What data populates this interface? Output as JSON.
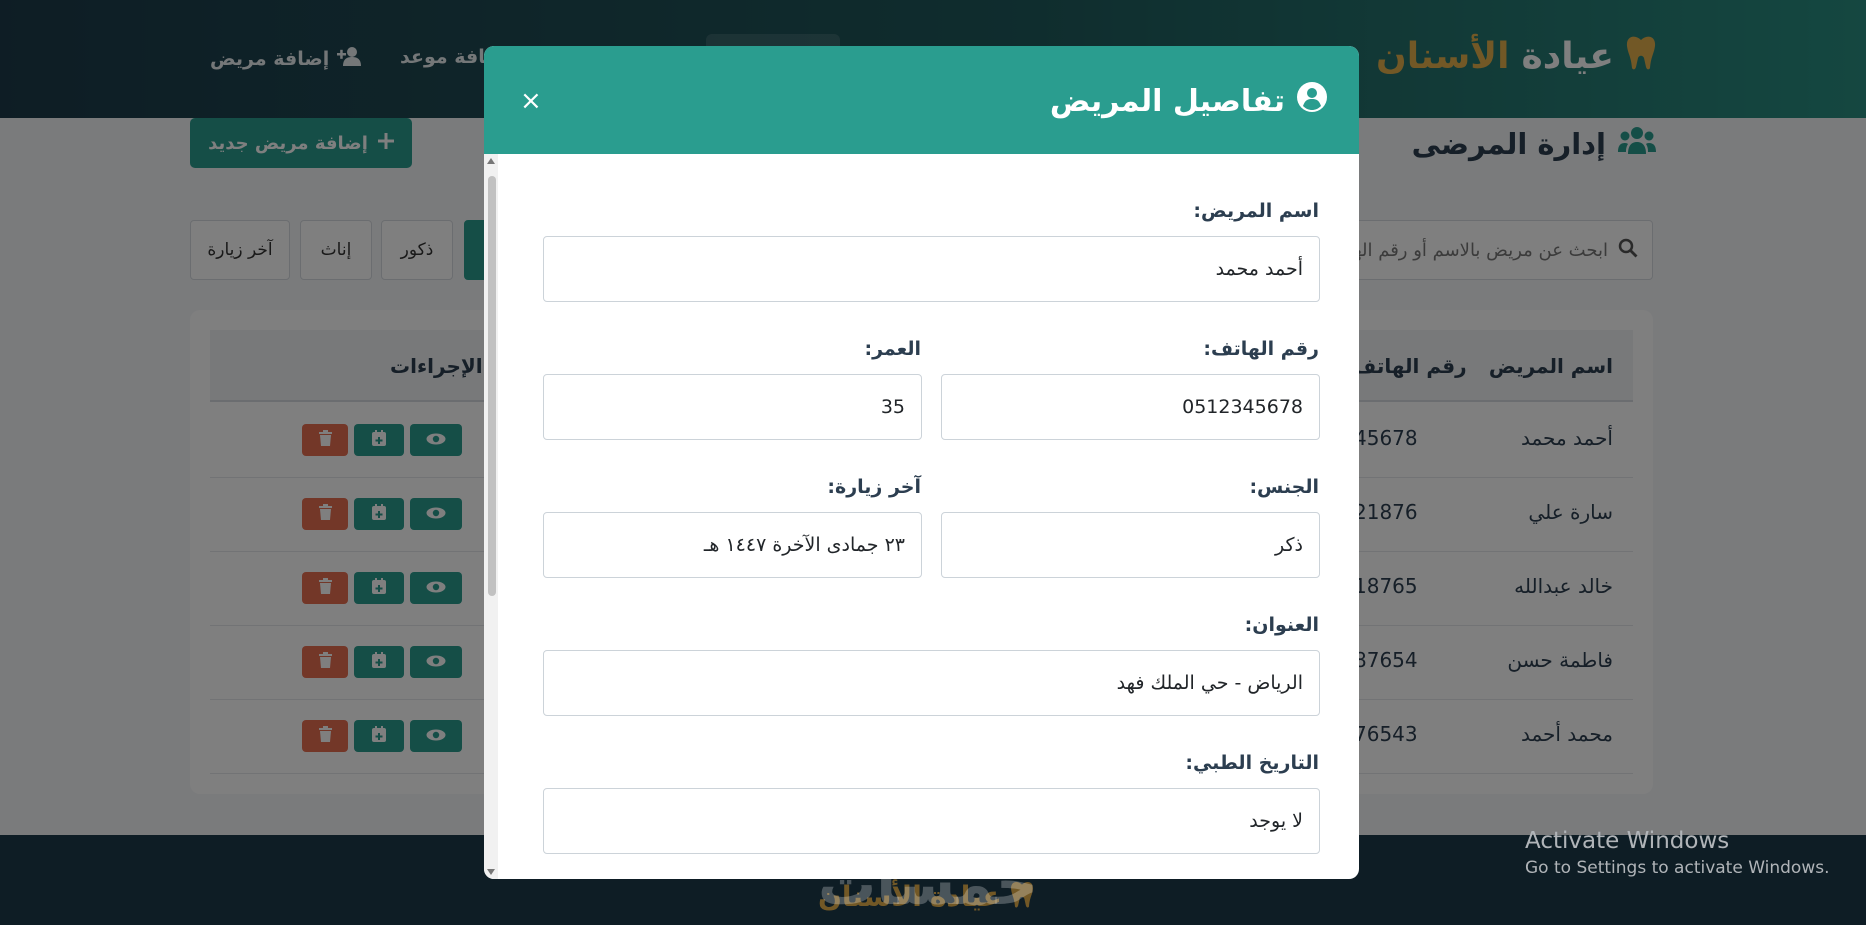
{
  "navbar": {
    "brand_main": "عيادة",
    "brand_accent": "الأسنان",
    "add_appointment": "إضافة موعد",
    "add_patient": "إضافة مريض"
  },
  "page": {
    "title": "إدارة المرضى",
    "add_button": "إضافة مريض جديد",
    "search_placeholder": "ابحث عن مريض بالاسم أو رقم الهاتف",
    "filters": {
      "last_visit": "آخر زيارة",
      "females": "إناث",
      "males": "ذكور"
    }
  },
  "table": {
    "headers": {
      "name": "اسم المريض",
      "phone": "رقم الهاتف",
      "actions": "الإجراءات"
    },
    "rows": [
      {
        "name": "أحمد محمد",
        "phone": "45678"
      },
      {
        "name": "سارة علي",
        "phone": "21876"
      },
      {
        "name": "خالد عبدالله",
        "phone": "18765"
      },
      {
        "name": "فاطمة حسن",
        "phone": "87654"
      },
      {
        "name": "محمد أحمد",
        "phone": "76543"
      }
    ]
  },
  "modal": {
    "title": "تفاصيل المريض",
    "close": "×",
    "fields": {
      "name_label": "اسم المريض:",
      "name_value": "أحمد محمد",
      "phone_label": "رقم الهاتف:",
      "phone_value": "0512345678",
      "age_label": "العمر:",
      "age_value": "35",
      "gender_label": "الجنس:",
      "gender_value": "ذكر",
      "last_visit_label": "آخر زيارة:",
      "last_visit_value": "٢٣ جمادى الآخرة ١٤٤٧ هـ",
      "address_label": "العنوان:",
      "address_value": "الرياض - حي الملك فهد",
      "history_label": "التاريخ الطبي:",
      "history_value": "لا يوجد"
    }
  },
  "footer": {
    "brand_main": "عيادة",
    "brand_accent": "الأسنان",
    "watermark": "خمسات"
  },
  "windows": {
    "activate_title": "Activate Windows",
    "activate_sub": "Go to Settings to activate Windows."
  },
  "colors": {
    "primary": "#2a9d8f",
    "danger": "#e76f51",
    "accent": "#e5b04d",
    "dark": "#1d3b4a"
  }
}
